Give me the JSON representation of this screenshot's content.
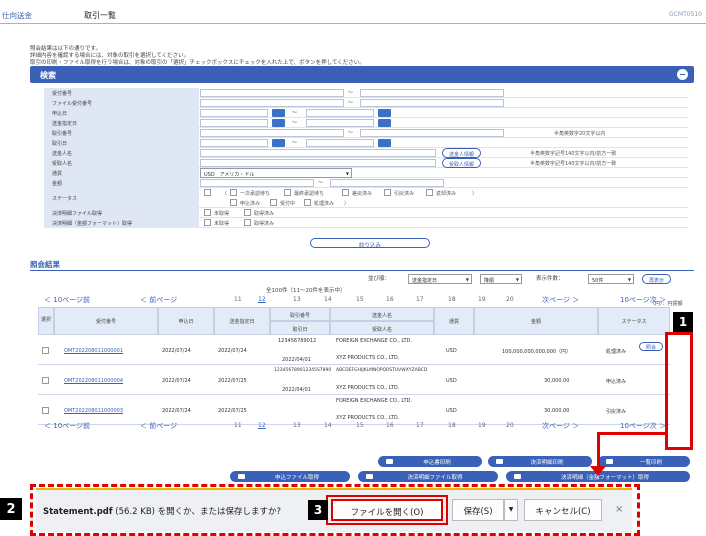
{
  "header": {
    "service": "仕向送金",
    "title": "取引一覧",
    "code": "GCMT0510"
  },
  "intro": [
    "照会結果は以下の通りです。",
    "詳細内容を確認する場合には、対象の取引を選択してください。",
    "取引の印刷・ファイル取得を行う場合は、対象の取引の「選択」チェックボックスにチェックを入れた上で、ボタンを押してください。"
  ],
  "search": {
    "label": "検索",
    "fields": [
      "受付番号",
      "ファイル受付番号",
      "申込日",
      "送金指定日",
      "取引番号",
      "取引日",
      "送金人名",
      "受取人名",
      "通貨",
      "金額",
      "ステータス",
      "",
      "決済明細ファイル取得",
      "決済明細（金額フォーマット）取得"
    ],
    "hint_ref": "半角英数字20文字以内",
    "sender_btn": "送金人情報",
    "payee_btn": "受取人情報",
    "hint_name": "半角英数字記号140文字以内/前方一致",
    "currency": "USD　アメリカ・ドル",
    "status1": [
      "一次承認待ち",
      "最終承認待ち",
      "差戻済み",
      "引戻済み",
      "返却済み"
    ],
    "status2": [
      "申込済み",
      "受付中",
      "処理済み"
    ],
    "acq": [
      "未取得",
      "取得済み"
    ],
    "narrow": "絞り込み"
  },
  "results": {
    "label": "照会結果",
    "sort_label": "並び順：",
    "sort_value": "送金指定日",
    "order": "降順",
    "count_label": "表示件数：",
    "count_value": "50件",
    "redisplay": "再表示",
    "unit": "（円）：円貨額",
    "summary": "全100件（11～20件を表示中）",
    "prev10": "10ページ前",
    "prev": "前ページ",
    "next": "次ページ",
    "next10": "10ページ次",
    "pages": [
      "11",
      "12",
      "13",
      "14",
      "15",
      "16",
      "17",
      "18",
      "19",
      "20"
    ],
    "cols": {
      "sel": "選択",
      "ref": "受付番号",
      "apply": "申込日",
      "value_date": "送金指定日",
      "txn": "取引番号",
      "txn_date": "取引日",
      "sender": "送金人名",
      "payee": "受取人名",
      "cur": "通貨",
      "amount": "金額",
      "status": "ステータス"
    },
    "rows": [
      {
        "ref": "OMT202208011000001",
        "apply": "2022/07/24",
        "vdate": "2022/07/24",
        "txn": "123456789012",
        "txn_date": "2022/04/01",
        "sender": "FOREIGN EXCHANGE CO., LTD.",
        "payee": "XYZ PRODUCTS CO., LTD.",
        "cur": "USD",
        "amount": "100,000,000,000,000（円）",
        "status": "処理済み",
        "action": "照会"
      },
      {
        "ref": "OMT202208011000004",
        "apply": "2022/07/24",
        "vdate": "2022/07/25",
        "txn": "123456789012345S7890",
        "txn_date": "2022/04/01",
        "sender": "ABCDEFGHIJKLMNOPQRSTUVWXYZABCD",
        "payee": "XYZ PRODUCTS CO., LTD.",
        "cur": "USD",
        "amount": "30,000.00",
        "status": "申込済み",
        "action": ""
      },
      {
        "ref": "OMT202208011000003",
        "apply": "2022/07/24",
        "vdate": "2022/07/25",
        "txn": "",
        "txn_date": "",
        "sender": "FOREIGN EXCHANGE CO., LTD.",
        "payee": "XYZ PRODUCTS CO., LTD.",
        "cur": "USD",
        "amount": "30,000.00",
        "status": "引戻済み",
        "action": ""
      }
    ],
    "buttons": [
      "申込書印刷",
      "決済明細印刷",
      "一覧印刷",
      "申込ファイル取得",
      "決済明細ファイル取得",
      "決済明細（金額フォーマット）取得"
    ]
  },
  "download": {
    "file": "Statement.pdf",
    "size": "(56.2 KB)",
    "message": "を開くか、または保存しますか?",
    "open": "ファイルを開く(O)",
    "save": "保存(S)",
    "cancel": "キャンセル(C)",
    "close": "×"
  },
  "callouts": {
    "b1": "1",
    "b2": "2",
    "b3": "3"
  }
}
